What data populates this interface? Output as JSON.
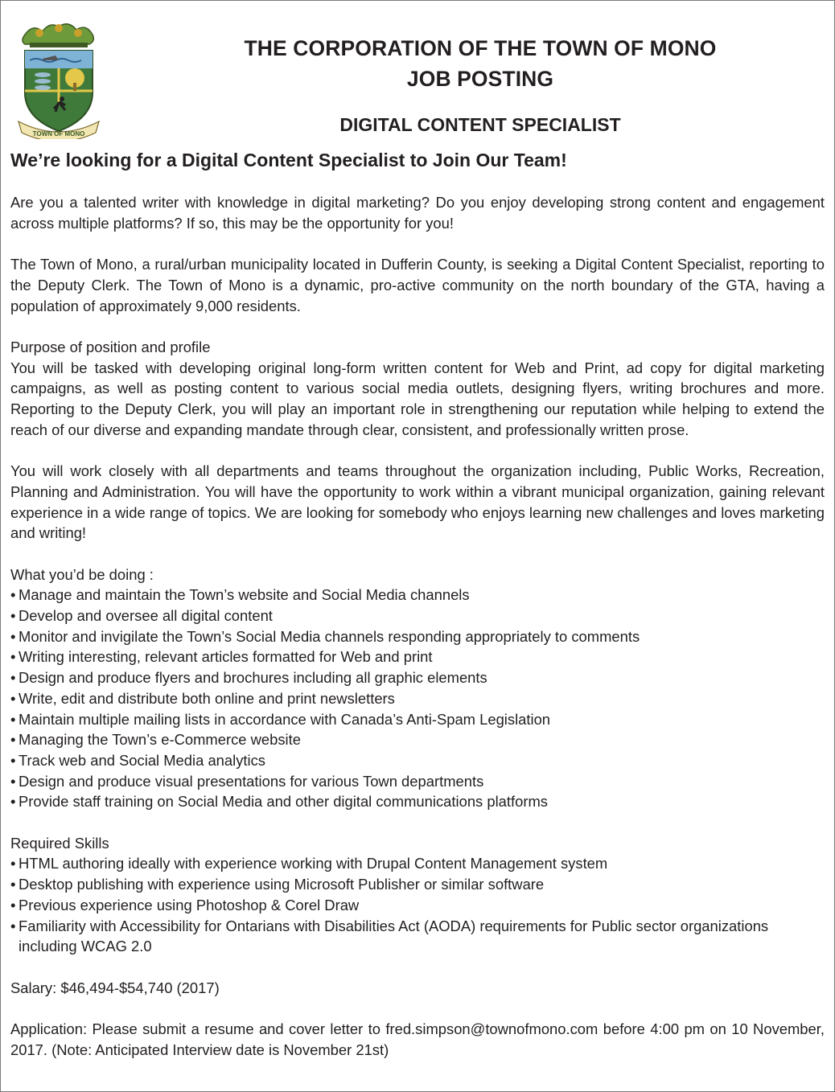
{
  "header": {
    "org_title": "THE CORPORATION OF THE TOWN OF MONO",
    "posting_label": "JOB POSTING",
    "position_title": "DIGITAL CONTENT SPECIALIST",
    "crest_text": "TOWN OF MONO"
  },
  "headline": "We’re looking for a Digital Content Specialist to Join Our Team!",
  "intro": "Are you a talented writer with knowledge in digital marketing? Do you enjoy developing strong content and engagement across multiple platforms? If so, this may be the opportunity for you!",
  "about": "The Town of Mono, a rural/urban municipality located in Dufferin County, is seeking a Digital Content Specialist, reporting to the Deputy Clerk. The Town of Mono is a dynamic, pro-active community on the north boundary of the GTA, having a population of approximately 9,000 residents.",
  "purpose": {
    "title": "Purpose of position and profile",
    "text": "You will be tasked with developing original long-form written content for Web and Print, ad copy for digital marketing campaigns, as well as posting content to various social media outlets, designing flyers, writing brochures and more. Reporting to the Deputy Clerk, you will play an important role in strengthening our reputation while helping to extend the reach of our diverse and expanding mandate through clear, consistent, and professionally written prose."
  },
  "teams": "You will work closely with all departments and teams throughout the organization including, Public Works, Recreation, Planning and Administration. You will have the opportunity to work within a vibrant municipal organization, gaining relevant experience in a wide range of topics. We are looking for somebody who enjoys learning new challenges and loves marketing and writing!",
  "duties": {
    "title": "What you’d be doing :",
    "items": [
      "Manage and maintain the Town’s website and Social Media channels",
      "Develop and oversee all digital content",
      "Monitor and invigilate the Town’s Social Media channels responding appropriately to comments",
      "Writing interesting, relevant articles formatted for Web and print",
      "Design and produce flyers and brochures including all graphic elements",
      "Write, edit and distribute both online and print newsletters",
      "Maintain multiple mailing lists in accordance with Canada’s Anti-Spam Legislation",
      "Managing the Town’s e-Commerce website",
      "Track web and Social Media analytics",
      "Design and produce visual presentations for various Town departments",
      "Provide staff training on Social Media and other digital communications platforms"
    ]
  },
  "skills": {
    "title": "Required Skills",
    "items": [
      "HTML authoring ideally with experience working with Drupal Content Management system",
      "Desktop publishing with experience using Microsoft Publisher or similar software",
      "Previous experience using Photoshop & Corel Draw",
      "Familiarity with Accessibility for Ontarians with Disabilities Act (AODA) requirements for Public sector organizations including WCAG 2.0"
    ]
  },
  "salary": "Salary: $46,494-$54,740 (2017)",
  "application": "Application: Please submit a resume and cover letter to fred.simpson@townofmono.com before 4:00 pm on 10 November, 2017. (Note: Anticipated Interview date is November 21st)",
  "colors": {
    "text": "#231f20",
    "border": "#7a7a7a",
    "crest_green": "#3f7a3a",
    "crest_gold": "#e3c84a",
    "crest_blue": "#7fb3d5"
  }
}
